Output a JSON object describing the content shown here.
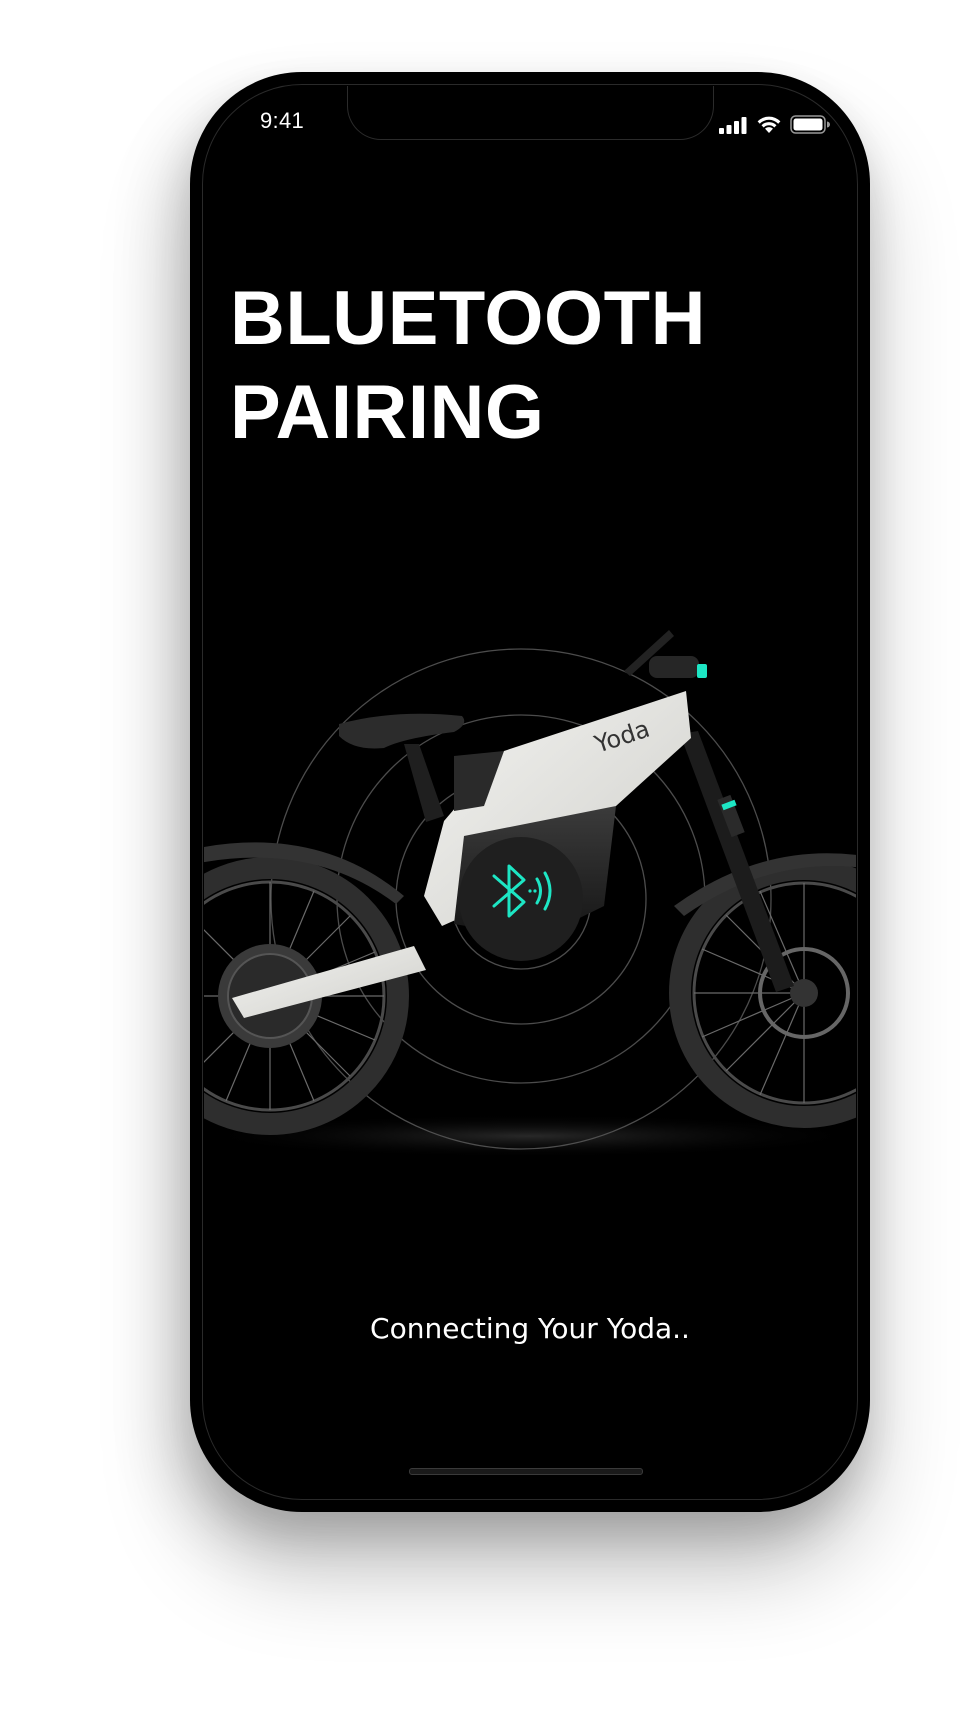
{
  "status_bar": {
    "time": "9:41",
    "icons": [
      "cellular-signal-icon",
      "wifi-icon",
      "battery-icon"
    ]
  },
  "screen": {
    "title": "BLUETOOTH\nPAIRING",
    "status_text": "Connecting Your Yoda..",
    "bike_brand": "Yoda",
    "bluetooth_icon": "bluetooth-signal-icon"
  },
  "colors": {
    "background": "#000000",
    "accent": "#1de6c4",
    "text": "#ffffff",
    "bike_body": "#e8e8e4"
  }
}
